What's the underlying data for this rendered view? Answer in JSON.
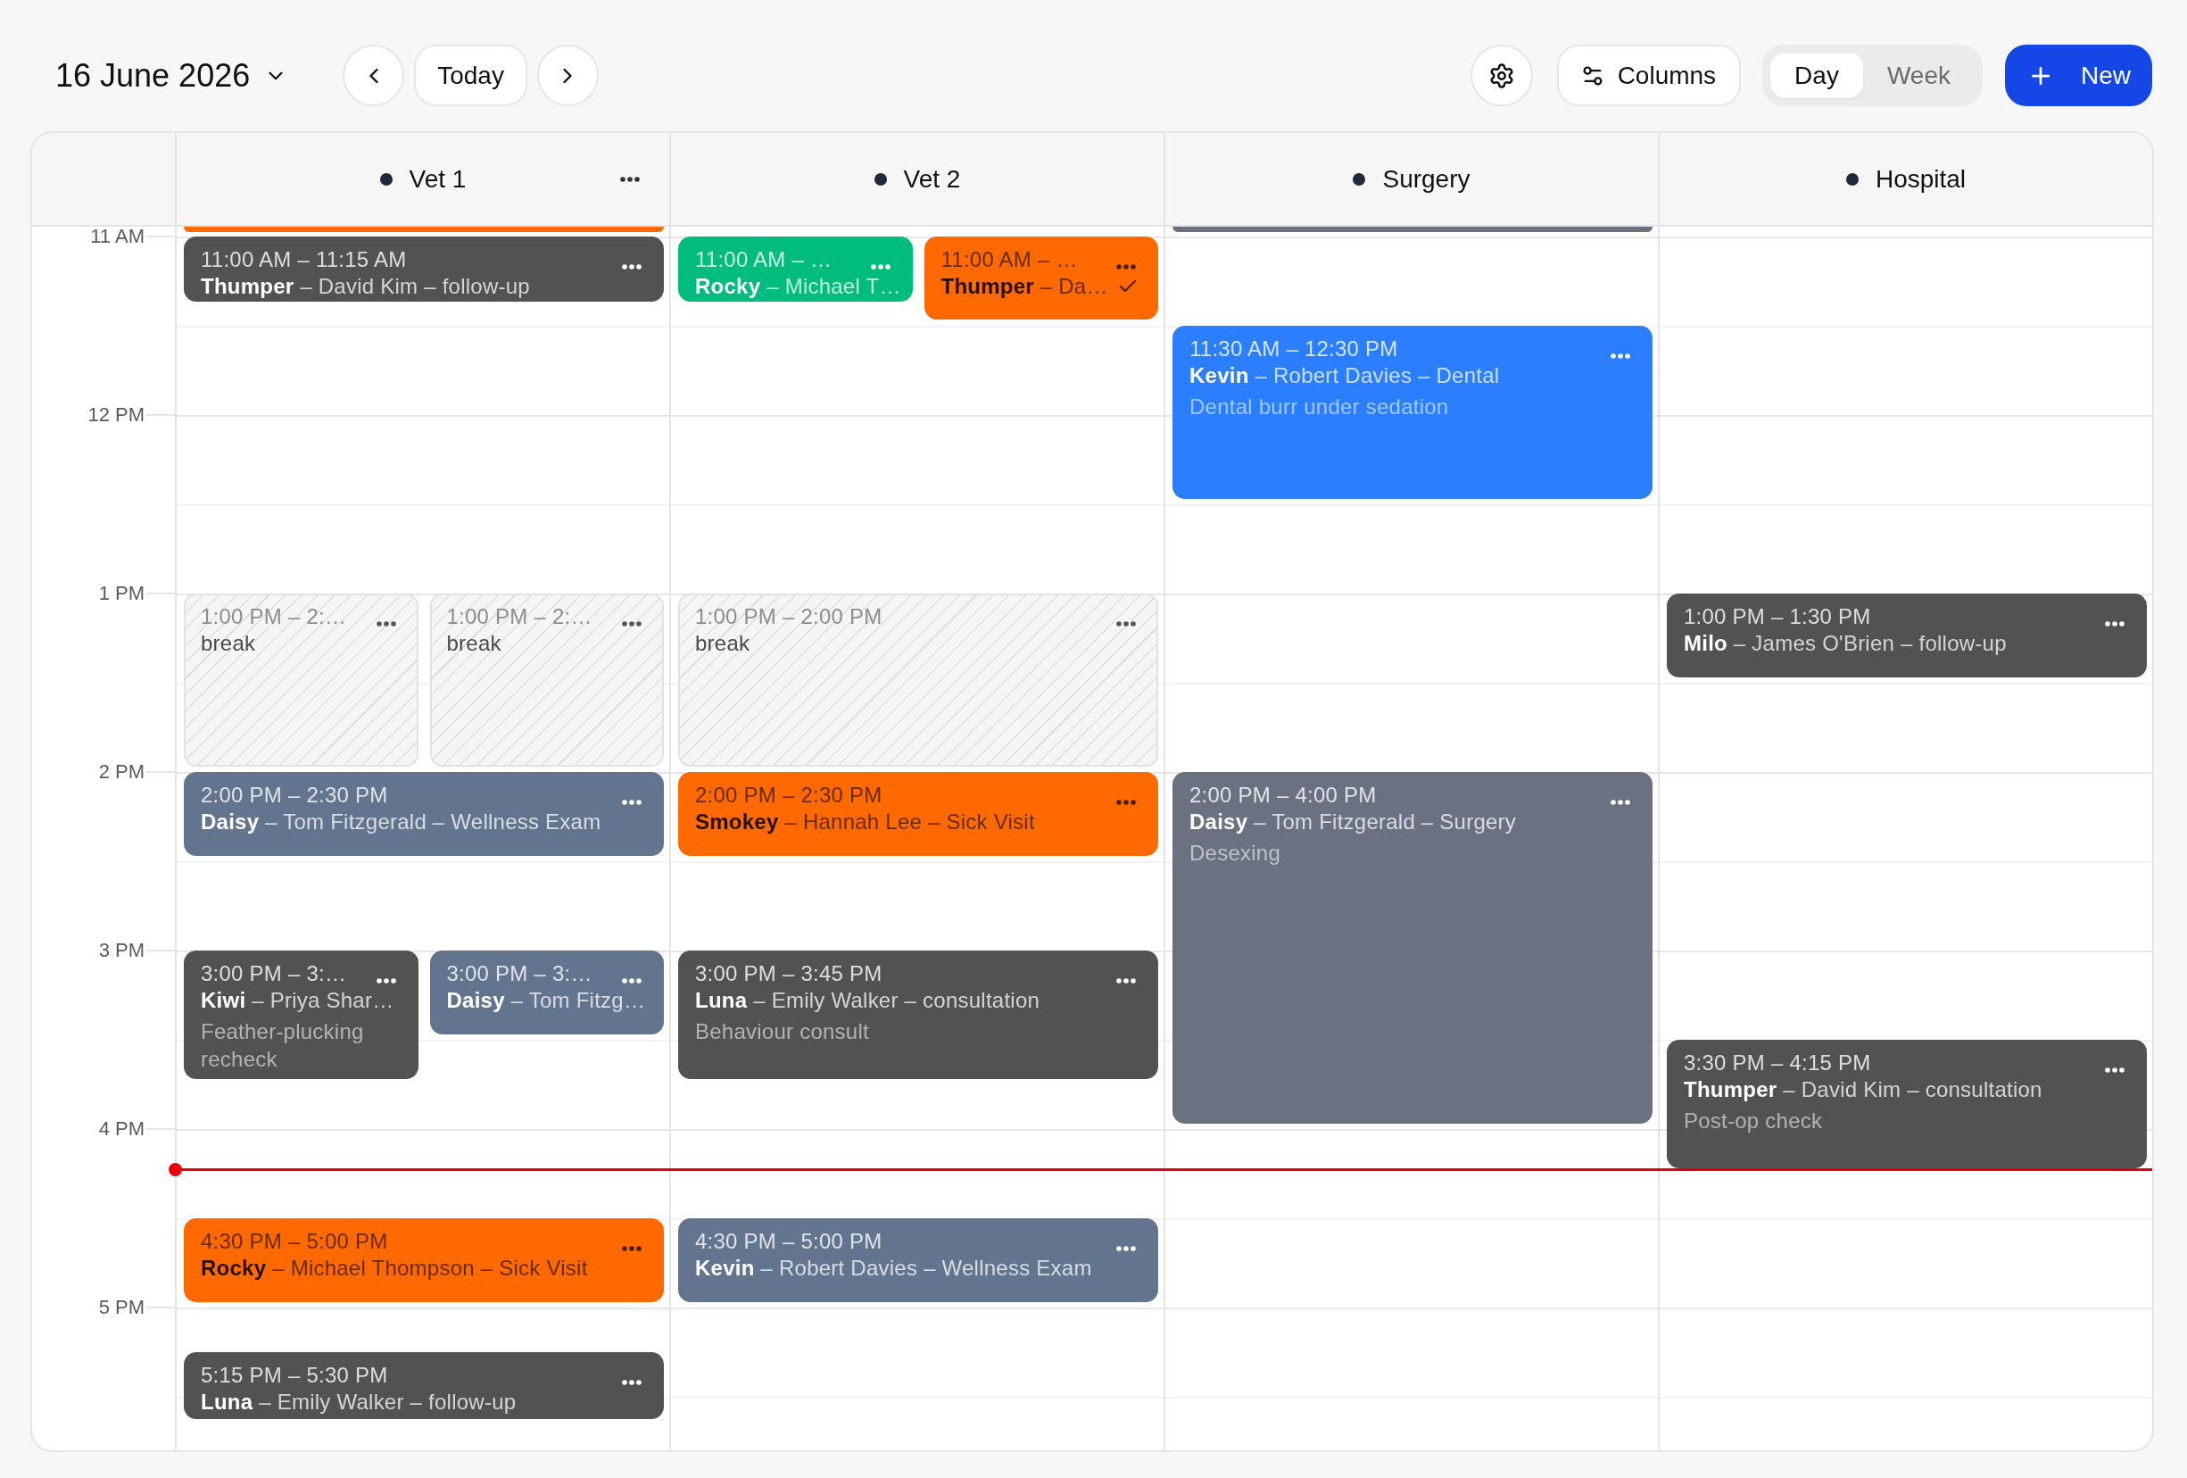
{
  "toolbar": {
    "date": "16 June 2026",
    "today_button": "Today",
    "columns_button": "Columns",
    "views": [
      {
        "label": "Day",
        "selected": true
      },
      {
        "label": "Week",
        "selected": false
      }
    ],
    "new_button": "New"
  },
  "resources": [
    {
      "name": "Vet 1",
      "hovered": true,
      "events": [
        {
          "kind": "clipped",
          "color": "#ff6900"
        },
        {
          "kind": "appointment",
          "color": "#525252",
          "time": "11:00 AM – 11:15 AM",
          "title": "**Thumper** – David Kim – follow-up",
          "confirmed": false
        },
        {
          "kind": "break",
          "time": "1:00 PM – 2:…",
          "title": "break"
        },
        {
          "kind": "break",
          "time": "1:00 PM – 2:…",
          "title": "break"
        },
        {
          "kind": "appointment",
          "color": "#62748e",
          "time": "2:00 PM – 2:30 PM",
          "title": "**Daisy** – Tom Fitzgerald – Wellness Exam",
          "confirmed": false
        },
        {
          "kind": "appointment",
          "color": "#525252",
          "time": "3:00 PM – 3:…",
          "title": "**Kiwi** – Priya Shar…",
          "note": "Feather-plucking recheck",
          "confirmed": false
        },
        {
          "kind": "appointment",
          "color": "#62748e",
          "time": "3:00 PM – 3:…",
          "title": "**Daisy** – Tom Fitzg…",
          "confirmed": false
        },
        {
          "kind": "appointment",
          "color": "#ff6900",
          "time": "4:30 PM – 5:00 PM",
          "title": "**Rocky** – Michael Thompson – Sick Visit",
          "confirmed": false
        },
        {
          "kind": "appointment",
          "color": "#525252",
          "time": "5:15 PM – 5:30 PM",
          "title": "**Luna** – Emily Walker – follow-up",
          "confirmed": false
        }
      ]
    },
    {
      "name": "Vet 2",
      "hovered": false,
      "events": [
        {
          "kind": "appointment",
          "color": "#00bc7d",
          "time": "11:00 AM – …",
          "title": "**Rocky** – Michael T…",
          "confirmed": false
        },
        {
          "kind": "appointment",
          "color": "#ff6900",
          "time": "11:00 AM – …",
          "title": "**Thumper** – Da…",
          "confirmed": true
        },
        {
          "kind": "break",
          "time": "1:00 PM – 2:00 PM",
          "title": "break"
        },
        {
          "kind": "appointment",
          "color": "#ff6900",
          "time": "2:00 PM – 2:30 PM",
          "title": "**Smokey** – Hannah Lee – Sick Visit",
          "confirmed": false
        },
        {
          "kind": "appointment",
          "color": "#525252",
          "time": "3:00 PM – 3:45 PM",
          "title": "**Luna** – Emily Walker – consultation",
          "note": "Behaviour consult",
          "confirmed": false
        },
        {
          "kind": "appointment",
          "color": "#62748e",
          "time": "4:30 PM – 5:00 PM",
          "title": "**Kevin** – Robert Davies – Wellness Exam",
          "confirmed": false
        }
      ]
    },
    {
      "name": "Surgery",
      "hovered": false,
      "events": [
        {
          "kind": "clipped",
          "color": "#6a7282"
        },
        {
          "kind": "appointment",
          "color": "#2b7fff",
          "time": "11:30 AM – 12:30 PM",
          "title": "**Kevin** – Robert Davies – Dental",
          "note": "Dental burr under sedation",
          "confirmed": false
        },
        {
          "kind": "appointment",
          "color": "#6a7282",
          "time": "2:00 PM – 4:00 PM",
          "title": "**Daisy** – Tom Fitzgerald – Surgery",
          "note": "Desexing",
          "confirmed": false
        }
      ]
    },
    {
      "name": "Hospital",
      "hovered": false,
      "events": [
        {
          "kind": "appointment",
          "color": "#525252",
          "time": "1:00 PM – 1:30 PM",
          "title": "**Milo** – James O'Brien – follow-up",
          "confirmed": false
        },
        {
          "kind": "appointment",
          "color": "#525252",
          "time": "3:30 PM – 4:15 PM",
          "title": "**Thumper** – David Kim – consultation",
          "note": "Post-op check",
          "confirmed": false
        }
      ]
    }
  ],
  "time_labels": [
    "11 AM",
    "12 PM",
    "1 PM",
    "2 PM",
    "3 PM",
    "4 PM",
    "5 PM"
  ]
}
